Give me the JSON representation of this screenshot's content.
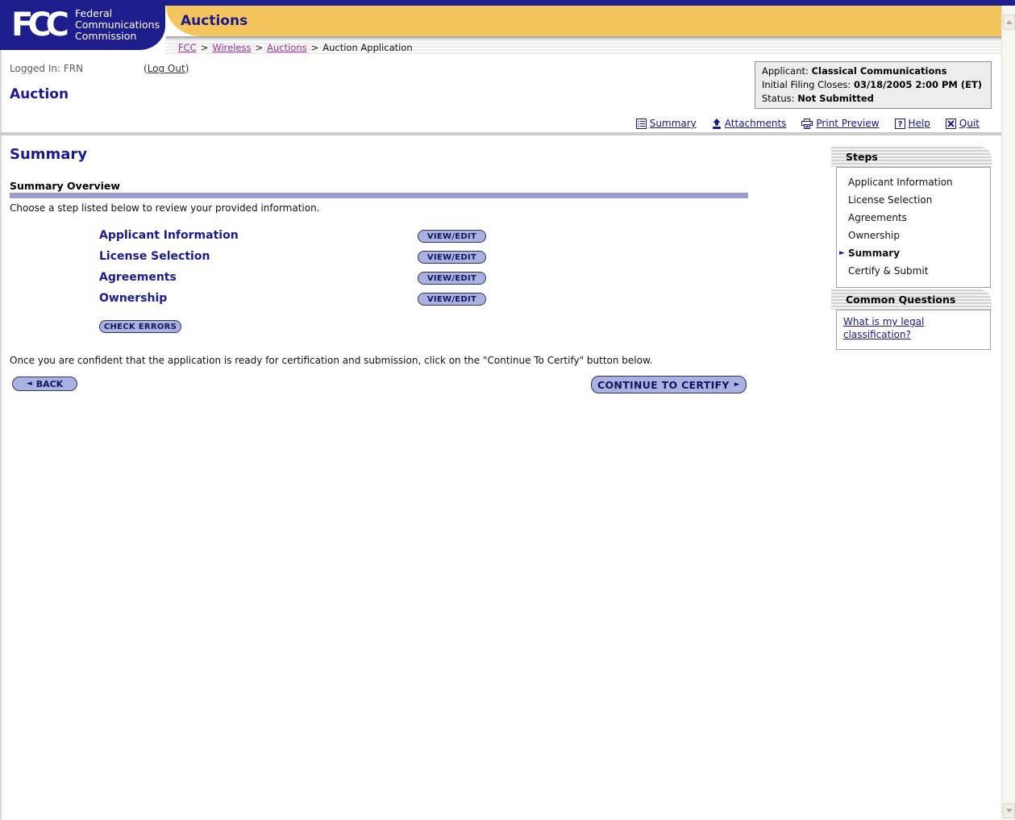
{
  "colors": {
    "navy": "#1d1d8c",
    "gold": "#f4c55c",
    "button_fill": "#a9b2e1",
    "purple_bar": "#9c9cce",
    "breadcrumb_link": "#993399",
    "box_background": "#ededed"
  },
  "header": {
    "logo_mark": "FCC",
    "logo_lines": [
      "Federal",
      "Communications",
      "Commission"
    ],
    "app_title": "Auctions",
    "breadcrumb": {
      "links": [
        "FCC",
        "Wireless",
        "Auctions"
      ],
      "separator": ">",
      "current": "Auction Application"
    }
  },
  "session": {
    "logged_in": "Logged In: FRN",
    "logout_pre": "(",
    "logout_link": "Log Out",
    "logout_post": ")"
  },
  "applicant_box": {
    "rows": [
      {
        "label": "Applicant: ",
        "value": "Classical Communications"
      },
      {
        "label": "Initial Filing Closes: ",
        "value": "03/18/2005 2:00 PM (ET)"
      },
      {
        "label": "Status: ",
        "value": "Not Submitted"
      }
    ]
  },
  "page": {
    "section_title": "Auction",
    "title": "Summary"
  },
  "toolbar": {
    "items": [
      {
        "label": "Summary",
        "icon": "summary-list-icon"
      },
      {
        "label": "Attachments",
        "icon": "attachments-icon"
      },
      {
        "label": "Print Preview",
        "icon": "printer-icon"
      },
      {
        "label": "Help",
        "icon": "help-icon"
      },
      {
        "label": "Quit",
        "icon": "quit-icon"
      }
    ]
  },
  "summary_section": {
    "heading": "Summary Overview",
    "instruction": "Choose a step listed below to review your provided information.",
    "steps": [
      {
        "label": "Applicant Information",
        "button": "VIEW/EDIT"
      },
      {
        "label": "License Selection",
        "button": "VIEW/EDIT"
      },
      {
        "label": "Agreements",
        "button": "VIEW/EDIT"
      },
      {
        "label": "Ownership",
        "button": "VIEW/EDIT"
      }
    ],
    "check_errors_button": "CHECK ERRORS",
    "certify_instruction": "Once you are confident that the application is ready for certification and submission, click on the \"Continue To Certify\" button below.",
    "back_button": "BACK",
    "continue_button": "CONTINUE TO CERTIFY"
  },
  "steps_panel": {
    "title": "Steps",
    "items": [
      {
        "label": "Applicant Information",
        "current": false
      },
      {
        "label": "License Selection",
        "current": false
      },
      {
        "label": "Agreements",
        "current": false
      },
      {
        "label": "Ownership",
        "current": false
      },
      {
        "label": "Summary",
        "current": true
      },
      {
        "label": "Certify & Submit",
        "current": false
      }
    ]
  },
  "common_questions": {
    "title": "Common Questions",
    "link": "What is my legal classification?"
  }
}
